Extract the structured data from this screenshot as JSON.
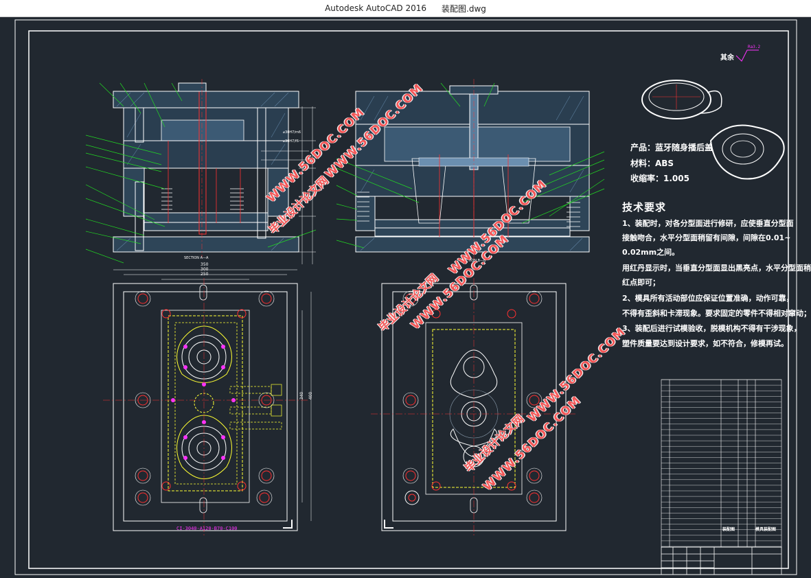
{
  "window": {
    "app_name": "Autodesk AutoCAD 2016",
    "file_name": "装配图.dwg"
  },
  "drawing": {
    "roughness_label": "其余",
    "roughness_value": "Ra3.2",
    "section_a_label": "SECTION A—A",
    "section_b_label": "SECTION B—B",
    "model_code": "CI-3040-A120-B70-C100",
    "dimensions": {
      "top_350": "350",
      "top_300": "300",
      "top_250": "250",
      "side_340": "340",
      "side_400": "400"
    },
    "fit_labels": [
      "⌀30H7/m6",
      "⌀30H7/f6"
    ],
    "product": {
      "name": "产品：蓝牙随身播后盖",
      "material": "材料：ABS",
      "shrinkage": "收缩率：1.005"
    },
    "tech_title": "技术要求",
    "tech_lines": [
      "1、装配时，对各分型面进行修研，应使垂直分型面",
      "接触吻合，水平分型面稍留有间隙，间隙在0.01~",
      "0.02mm之间。",
      "用红丹显示时，当垂直分型面显出黑亮点，水平分型面稍见",
      "红点即可；",
      "2、模具所有活动部位应保证位置准确，动作可靠，",
      "不得有歪斜和卡滞现象。要求固定的零件不得相对窜动；",
      "3、装配后进行试模验收，脱模机构不得有干涉现象，",
      "塑件质量要达到设计要求，如不符合，修模再试。"
    ],
    "title_block": {
      "drawing_name": "模具装配图",
      "company_cell": "装配图"
    },
    "watermarks": {
      "site_cn": "毕业设计论文网",
      "site_url": "WWW.56DOC.COM"
    },
    "colors": {
      "frame": "#ffffff",
      "green": "#22dd22",
      "red": "#ff3030",
      "yellow": "#ffff33",
      "magenta": "#ff33ff",
      "cyan": "#00e5e5",
      "hatch": "#4a6a8a"
    }
  }
}
